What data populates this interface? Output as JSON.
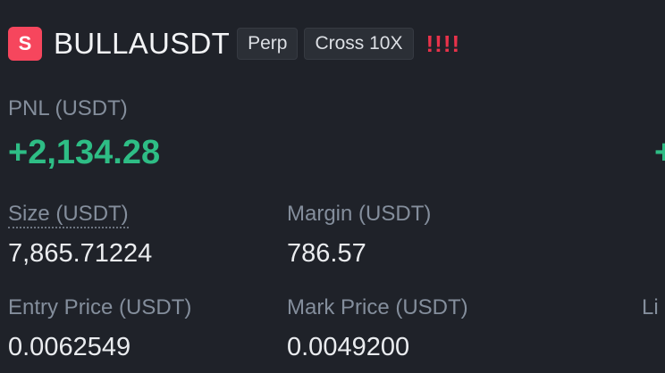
{
  "position": {
    "side_letter": "S",
    "symbol": "BULLAUSDT",
    "tags": [
      "Perp",
      "Cross 10X"
    ],
    "warning": "!!!!",
    "colors": {
      "short": "#f6465d",
      "profit": "#2ebd85",
      "warning": "#e8324a"
    }
  },
  "pnl": {
    "label": "PNL (USDT)",
    "value": "+2,134.28",
    "edge_partial": "+"
  },
  "size": {
    "label": "Size (USDT)",
    "value": "7,865.71224"
  },
  "margin": {
    "label": "Margin (USDT)",
    "value": "786.57"
  },
  "entry_price": {
    "label": "Entry Price (USDT)",
    "value": "0.0062549"
  },
  "mark_price": {
    "label": "Mark Price (USDT)",
    "value": "0.0049200"
  },
  "liq_price": {
    "label_partial": "Li"
  }
}
